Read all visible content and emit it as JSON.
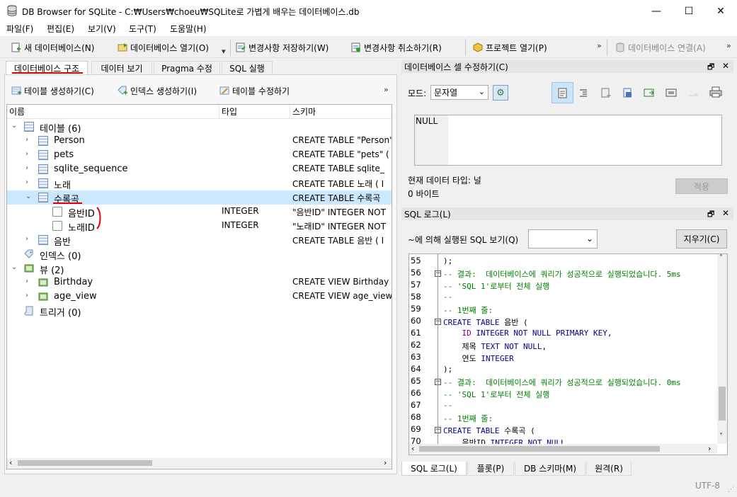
{
  "window": {
    "title": "DB Browser for SQLite - C:₩Users₩choeu₩SQLite로 가볍게 배우는 데이터베이스.db",
    "minimize": "—",
    "maximize": "☐",
    "close": "✕"
  },
  "menu": [
    "파일(F)",
    "편집(E)",
    "보기(V)",
    "도구(T)",
    "도움말(H)"
  ],
  "toolbar": {
    "new_db": "새 데이터베이스(N)",
    "open_db": "데이터베이스 열기(O)",
    "save_changes": "변경사항 저장하기(W)",
    "revert_changes": "변경사항 취소하기(R)",
    "open_project": "프로젝트 열기(P)",
    "attach_db": "데이터베이스 연결(A)",
    "more": "»"
  },
  "main_tabs": [
    "데이터베이스 구조",
    "데이터 보기",
    "Pragma 수정",
    "SQL 실행"
  ],
  "structure_toolbar": {
    "create_table": "테이블 생성하기(C)",
    "create_index": "인덱스 생성하기(I)",
    "modify_table": "테이블 수정하기",
    "more": "»"
  },
  "tree": {
    "headers": [
      "이름",
      "타입",
      "스키마"
    ],
    "rows": [
      {
        "name": "테이블 (6)",
        "type": "",
        "schema": ""
      },
      {
        "name": "Person",
        "type": "",
        "schema": "CREATE TABLE \"Person\""
      },
      {
        "name": "pets",
        "type": "",
        "schema": "CREATE TABLE \"pets\" ("
      },
      {
        "name": "sqlite_sequence",
        "type": "",
        "schema": "CREATE TABLE sqlite_"
      },
      {
        "name": "노래",
        "type": "",
        "schema": "CREATE TABLE 노래 ( I"
      },
      {
        "name": "수록곡",
        "type": "",
        "schema": "CREATE TABLE 수록곡"
      },
      {
        "name": "음반ID",
        "type": "INTEGER",
        "schema": "\"음반ID\" INTEGER NOT"
      },
      {
        "name": "노래ID",
        "type": "INTEGER",
        "schema": "\"노래ID\" INTEGER NOT"
      },
      {
        "name": "음반",
        "type": "",
        "schema": "CREATE TABLE 음반 ( I"
      },
      {
        "name": "인덱스 (0)",
        "type": "",
        "schema": ""
      },
      {
        "name": "뷰 (2)",
        "type": "",
        "schema": ""
      },
      {
        "name": "Birthday",
        "type": "",
        "schema": "CREATE VIEW Birthday"
      },
      {
        "name": "age_view",
        "type": "",
        "schema": "CREATE VIEW age_view"
      },
      {
        "name": "트리거 (0)",
        "type": "",
        "schema": ""
      }
    ]
  },
  "cell_editor": {
    "title": "데이터베이스 셀 수정하기(C)",
    "mode_label": "모드:",
    "mode_value": "문자열",
    "content": "NULL",
    "data_type": "현재 데이터 타입: 널",
    "size": "0 바이트",
    "apply": "적용"
  },
  "sql_log": {
    "title": "SQL 로그(L)",
    "submitted_by_label": "~에 의해 실행된 SQL 보기(Q)",
    "clear": "지우기(C)",
    "lines": [
      {
        "n": "55",
        "text": ");"
      },
      {
        "n": "56",
        "text": "-- 결과:  데이터베이스에 쿼리가 성공적으로 실행되었습니다. 5ms"
      },
      {
        "n": "57",
        "text": "-- 'SQL 1'로부터 전체 실행"
      },
      {
        "n": "58",
        "text": "--"
      },
      {
        "n": "59",
        "text": "-- 1번째 줄:"
      },
      {
        "n": "60",
        "text": "CREATE TABLE 음반 ("
      },
      {
        "n": "61",
        "text": "    ID INTEGER NOT NULL PRIMARY KEY,"
      },
      {
        "n": "62",
        "text": "    제목 TEXT NOT NULL,"
      },
      {
        "n": "63",
        "text": "    연도 INTEGER"
      },
      {
        "n": "64",
        "text": ");"
      },
      {
        "n": "65",
        "text": "-- 결과:  데이터베이스에 쿼리가 성공적으로 실행되었습니다. 0ms"
      },
      {
        "n": "66",
        "text": "-- 'SQL 1'로부터 전체 실행"
      },
      {
        "n": "67",
        "text": "--"
      },
      {
        "n": "68",
        "text": "-- 1번째 줄:"
      },
      {
        "n": "69",
        "text": "CREATE TABLE 수록곡 ("
      },
      {
        "n": "70",
        "text": "    음반ID INTEGER NOT NULL,"
      }
    ]
  },
  "bottom_tabs": [
    "SQL 로그(L)",
    "플롯(P)",
    "DB 스키마(M)",
    "원격(R)"
  ],
  "status": {
    "encoding": "UTF-8"
  },
  "icons": {
    "app": "db-cylinder-icon",
    "table": "table-icon",
    "field": "field-icon",
    "index": "tag-icon",
    "view": "view-icon",
    "trigger": "trigger-icon"
  },
  "colors": {
    "selection": "#cce8ff",
    "annotation": "#e00000",
    "comment": "#008000",
    "keyword": "#00008b"
  }
}
